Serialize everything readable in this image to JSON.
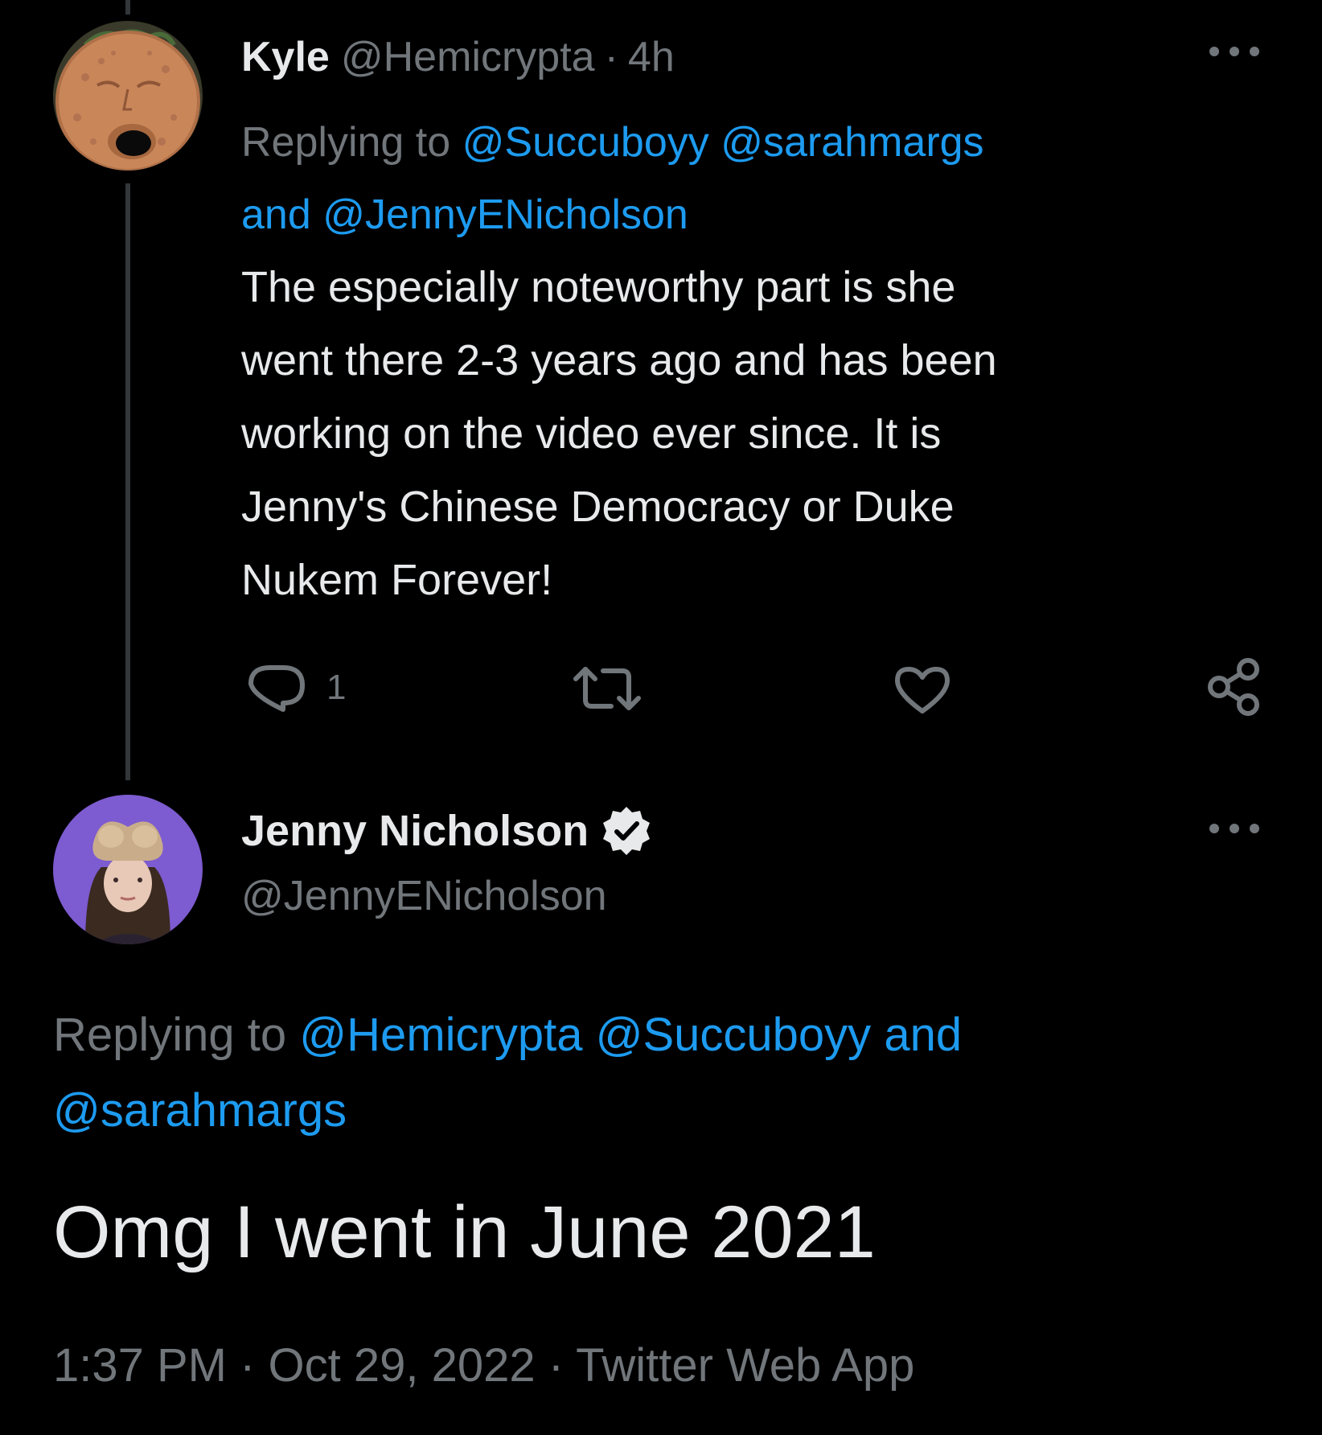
{
  "tweet1": {
    "display_name": "Kyle",
    "handle": "@Hemicrypta",
    "separator": "·",
    "age": "4h",
    "replying_prefix": "Replying to",
    "replying_to": [
      "@Succuboyy",
      "@sarahmargs"
    ],
    "replying_and": "and",
    "replying_last": "@JennyENicholson",
    "body_lines": [
      "The especially noteworthy part is she",
      "went there 2-3 years ago and has been",
      "working on the video ever since. It is",
      "Jenny's Chinese Democracy or Duke",
      "Nukem Forever!"
    ],
    "reply_count": "1",
    "icons": [
      "more-icon",
      "reply-icon",
      "retweet-icon",
      "like-icon",
      "share-icon"
    ]
  },
  "tweet2": {
    "display_name": "Jenny Nicholson",
    "handle": "@JennyENicholson",
    "verified": true,
    "replying_prefix": "Replying to",
    "replying_to": [
      "@Hemicrypta",
      "@Succuboyy"
    ],
    "replying_and": "and",
    "replying_last": "@sarahmargs",
    "body": "Omg I went in June 2021",
    "meta": "1:37 PM · Oct 29, 2022 · Twitter Web App"
  },
  "colors": {
    "background": "#000000",
    "text": "#e7e9ea",
    "muted": "#71767b",
    "link": "#1d9bf0",
    "thread_line": "#333639"
  }
}
